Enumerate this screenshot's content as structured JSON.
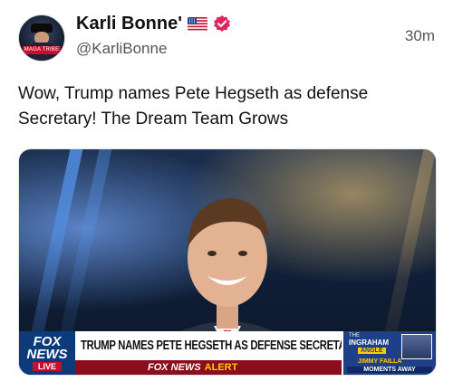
{
  "post": {
    "author": {
      "display_name": "Karli Bonne'",
      "handle": "@KarliBonne",
      "avatar_text": "MAGA TRIBE",
      "flag": "us-flag-icon",
      "verified": true,
      "verified_color": "#e0245e"
    },
    "timestamp": "30m",
    "text": "Wow, Trump names Pete Hegseth as defense Secretary! The Dream Team Grows",
    "media": {
      "lower_third": {
        "logo_line1": "FOX",
        "logo_line2": "NEWS",
        "logo_live": "LIVE",
        "headline": "TRUMP NAMES PETE HEGSETH AS DEFENSE SECRETARY",
        "alert_brand": "FOX NEWS",
        "alert_word": "ALERT",
        "show_tag": "THE",
        "show_name": "INGRAHAM",
        "show_sub": "ANGLE",
        "guest": "JIMMY FAILLA",
        "ticker": "MOMENTS AWAY"
      },
      "colors": {
        "fox_blue": "#0b3b7a",
        "alert_red": "#8c0e1c",
        "alert_yellow": "#ffcc00"
      }
    }
  }
}
